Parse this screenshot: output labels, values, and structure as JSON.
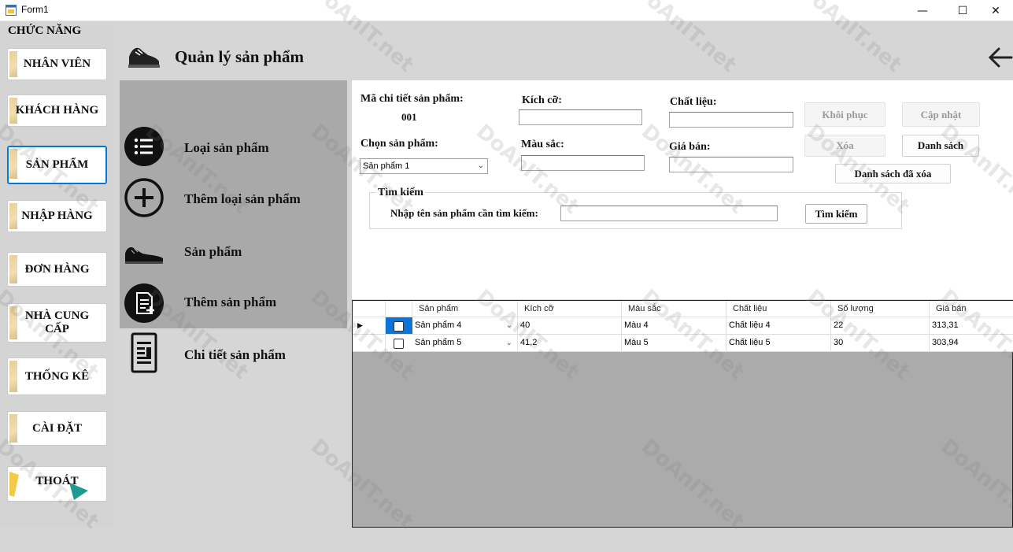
{
  "window": {
    "title": "Form1",
    "controls": {
      "minimize": "—",
      "maximize": "☐",
      "close": "✕"
    }
  },
  "leftmenu": {
    "heading": "CHỨC NĂNG",
    "items": [
      {
        "label": "NHÂN VIÊN"
      },
      {
        "label": "KHÁCH HÀNG"
      },
      {
        "label": "SẢN PHẨM"
      },
      {
        "label": "NHẬP HÀNG"
      },
      {
        "label": "ĐƠN HÀNG"
      },
      {
        "label": "NHÀ CUNG CẤP"
      },
      {
        "label": "THỐNG KÊ"
      },
      {
        "label": "CÀI ĐẶT"
      },
      {
        "label": "THOÁT"
      }
    ]
  },
  "header": {
    "title": "Quản lý sản phẩm",
    "icon": "sneaker-icon",
    "back_icon": "back-arrow-icon"
  },
  "submenu": {
    "items": [
      {
        "label": "Loại sản phẩm",
        "icon": "list-icon"
      },
      {
        "label": "Thêm loại sản phẩm",
        "icon": "add-circle-icon"
      },
      {
        "label": "Sản phẩm",
        "icon": "sneaker-icon"
      },
      {
        "label": "Thêm sản phẩm",
        "icon": "add-document-icon"
      },
      {
        "label": "Chi tiết sản phẩm",
        "icon": "document-icon"
      }
    ]
  },
  "form": {
    "ma_label": "Mã chi tiết sản phẩm:",
    "ma_value": "001",
    "kichco_label": "Kích cỡ:",
    "kichco_value": "",
    "chatlieu_label": "Chất liệu:",
    "chatlieu_value": "",
    "chonsp_label": "Chọn sản phẩm:",
    "chonsp_value": "Sản phẩm 1",
    "mausac_label": "Màu sắc:",
    "mausac_value": "",
    "giaban_label": "Giá bán:",
    "giaban_value": "",
    "buttons": {
      "khoiphuc": "Khôi phục",
      "capnhat": "Cập nhật",
      "xoa": "Xóa",
      "danhsach": "Danh sách",
      "danhsach_daxoa": "Danh sách đã xóa"
    },
    "search": {
      "group_title": "Tìm kiếm",
      "label": "Nhập tên sản phẩm cần tìm kiếm:",
      "value": "",
      "button": "Tìm kiếm"
    }
  },
  "grid": {
    "columns": [
      "Sản phẩm",
      "Kích cỡ",
      "Màu sắc",
      "Chất liệu",
      "Số lượng",
      "Giá bán"
    ],
    "rows": [
      {
        "sanpham": "Sản phẩm 4",
        "kichco": "40",
        "mausac": "Màu 4",
        "chatlieu": "Chất liệu 4",
        "soluong": "22",
        "giaban": "313,31",
        "checked": false,
        "current": true
      },
      {
        "sanpham": "Sản phẩm 5",
        "kichco": "41,2",
        "mausac": "Màu 5",
        "chatlieu": "Chất liệu 5",
        "soluong": "30",
        "giaban": "303,94",
        "checked": false,
        "current": false
      }
    ]
  },
  "watermark": {
    "text": "DoAnIT.net"
  },
  "colors": {
    "accent": "#0078d7",
    "panel": "#a9a9a9",
    "menu_deco": "#e8cf9a",
    "exit_triangle": "#1e9b8f"
  }
}
